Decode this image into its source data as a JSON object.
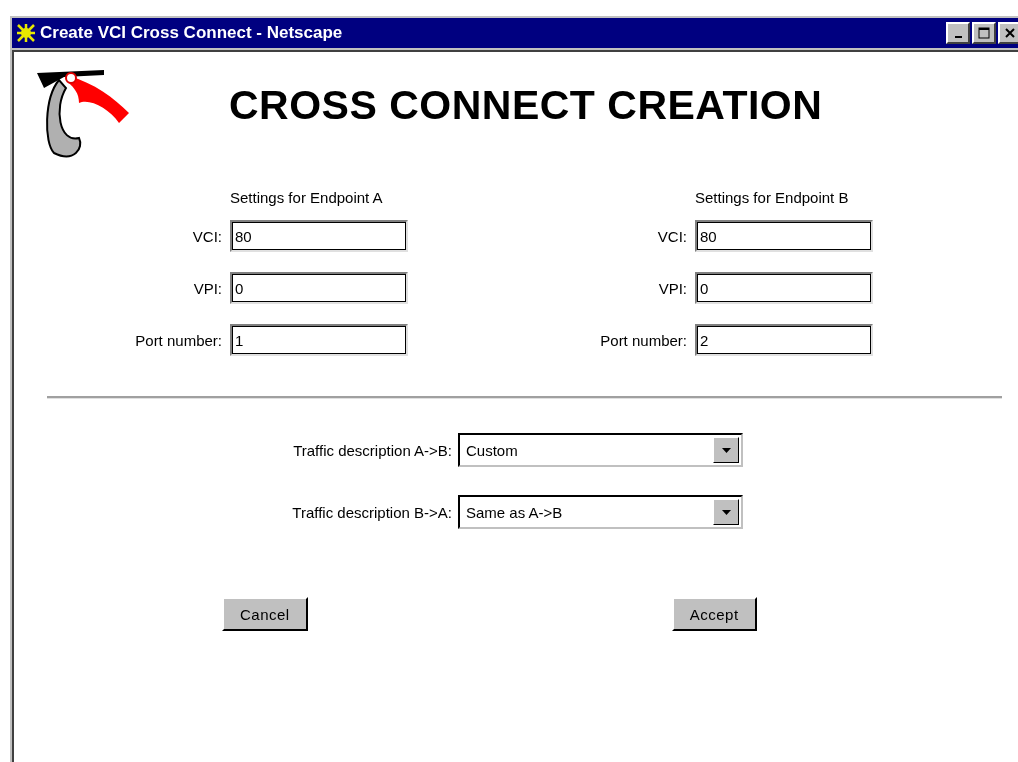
{
  "window": {
    "title": "Create VCI Cross Connect - Netscape"
  },
  "heading": "CROSS CONNECT CREATION",
  "endpoints": [
    {
      "title": "Settings for Endpoint A",
      "fields": [
        {
          "label": "VCI:",
          "value": "80"
        },
        {
          "label": "VPI:",
          "value": "0"
        },
        {
          "label": "Port number:",
          "value": "1"
        }
      ]
    },
    {
      "title": "Settings for Endpoint B",
      "fields": [
        {
          "label": "VCI:",
          "value": "80"
        },
        {
          "label": "VPI:",
          "value": "0"
        },
        {
          "label": "Port number:",
          "value": "2"
        }
      ]
    }
  ],
  "traffic": [
    {
      "label": "Traffic description A->B:",
      "value": "Custom"
    },
    {
      "label": "Traffic description B->A:",
      "value": "Same as A->B"
    }
  ],
  "buttons": [
    "Cancel",
    "Accept"
  ]
}
